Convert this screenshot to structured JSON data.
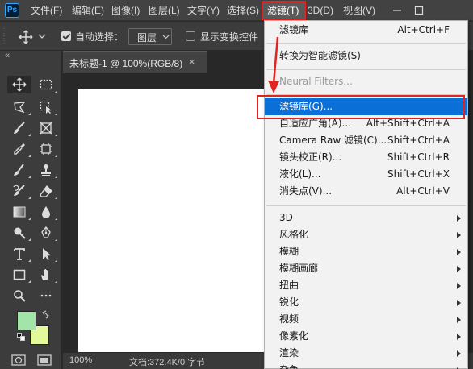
{
  "app": {
    "logo": "Ps"
  },
  "menubar": {
    "items": [
      {
        "label": "文件(F)"
      },
      {
        "label": "编辑(E)"
      },
      {
        "label": "图像(I)"
      },
      {
        "label": "图层(L)"
      },
      {
        "label": "文字(Y)"
      },
      {
        "label": "选择(S)"
      },
      {
        "label": "滤镜(T)"
      },
      {
        "label": "3D(D)"
      },
      {
        "label": "视图(V)"
      }
    ]
  },
  "options_bar": {
    "auto_select_label": "自动选择：",
    "auto_select_checked": true,
    "auto_select_value": "图层",
    "show_transform_label": "显示变换控件",
    "show_transform_checked": false
  },
  "toolbar": {
    "collapse_glyph": "«",
    "tools": [
      {
        "icon": "move-tool-icon"
      },
      {
        "icon": "marquee-tool-icon"
      },
      {
        "icon": "lasso-tool-icon"
      },
      {
        "icon": "object-select-tool-icon"
      },
      {
        "icon": "brush-tool-icon"
      },
      {
        "icon": "crop-tool-icon"
      },
      {
        "icon": "eyedropper-tool-icon"
      },
      {
        "icon": "frame-tool-icon"
      },
      {
        "icon": "spot-healing-icon"
      },
      {
        "icon": "stamp-tool-icon"
      },
      {
        "icon": "history-brush-icon"
      },
      {
        "icon": "eraser-tool-icon"
      },
      {
        "icon": "gradient-tool-icon"
      },
      {
        "icon": "blur-tool-icon"
      },
      {
        "icon": "dodge-tool-icon"
      },
      {
        "icon": "pen-tool-icon"
      },
      {
        "icon": "type-tool-icon"
      },
      {
        "icon": "path-select-icon"
      },
      {
        "icon": "rectangle-tool-icon"
      },
      {
        "icon": "hand-tool-icon"
      },
      {
        "icon": "zoom-tool-icon"
      }
    ],
    "foreground_color": "#a3e4a8",
    "background_color": "#e4f89c"
  },
  "document": {
    "tab_title": "未标题-1 @ 100%(RGB/8)",
    "tab_close": "×",
    "zoom": "100%",
    "doc_info": "文档:372.4K/0 字节"
  },
  "filter_menu": {
    "items": [
      {
        "label": "滤镜库",
        "shortcut": "Alt+Ctrl+F"
      },
      {
        "label": "转换为智能滤镜(S)",
        "shortcut": ""
      },
      {
        "label": "Neural Filters...",
        "shortcut": "",
        "disabled": true
      },
      {
        "label": "滤镜库(G)...",
        "shortcut": "",
        "highlighted": true
      },
      {
        "label": "自适应广角(A)...",
        "shortcut": "Alt+Shift+Ctrl+A"
      },
      {
        "label": "Camera Raw 滤镜(C)...",
        "shortcut": "Shift+Ctrl+A"
      },
      {
        "label": "镜头校正(R)...",
        "shortcut": "Shift+Ctrl+R"
      },
      {
        "label": "液化(L)...",
        "shortcut": "Shift+Ctrl+X"
      },
      {
        "label": "消失点(V)...",
        "shortcut": "Alt+Ctrl+V"
      }
    ],
    "submenus": [
      {
        "label": "3D"
      },
      {
        "label": "风格化"
      },
      {
        "label": "模糊"
      },
      {
        "label": "模糊画廊"
      },
      {
        "label": "扭曲"
      },
      {
        "label": "锐化"
      },
      {
        "label": "视频"
      },
      {
        "label": "像素化"
      },
      {
        "label": "渲染"
      },
      {
        "label": "杂色"
      }
    ]
  },
  "annotation": {
    "color": "#e3231f"
  }
}
